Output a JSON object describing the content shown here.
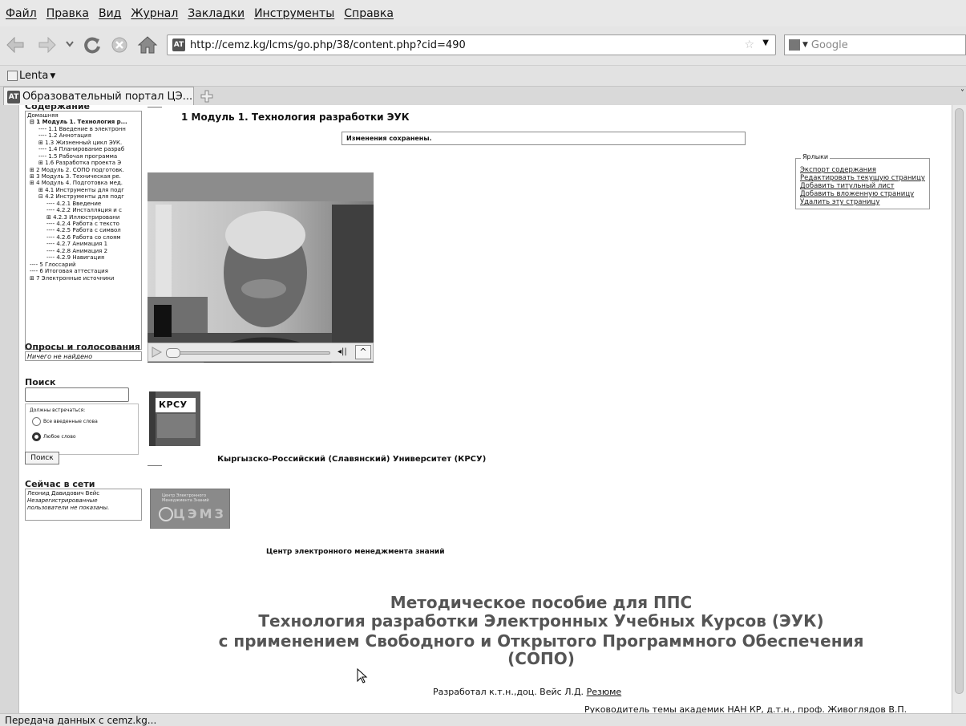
{
  "menu": [
    "Файл",
    "Правка",
    "Вид",
    "Журнал",
    "Закладки",
    "Инструменты",
    "Справка"
  ],
  "url": "http://cemz.kg/lcms/go.php/38/content.php?cid=490",
  "search_engine": "Google",
  "bookmarks_label": "Lenta",
  "tab": {
    "title": "Образовательный портал ЦЭ...",
    "site_icon": "AT"
  },
  "status": "Передача данных с cemz.kg...",
  "sidebar": {
    "contents_title": "Содержание",
    "tree": [
      "Домашняя",
      "⊟ 1 Модуль 1. Технология р...",
      "---- 1.1 Введение в электронн",
      "---- 1.2 Аннотация",
      "⊞ 1.3 Жизненный цикл ЭУК.",
      "---- 1.4 Планирование разраб",
      "---- 1.5 Рабочая программа",
      "⊞ 1.6 Разработка проекта Э",
      "⊞ 2 Модуль 2. СОПО подготовк.",
      "⊞ 3 Модуль 3. Техническая ре.",
      "⊞ 4 Модуль 4. Подготовка мед.",
      "⊞ 4.1 Инструменты для подг",
      "⊟ 4.2 Инструменты для подг",
      "---- 4.2.1 Введение",
      "---- 4.2.2 Инсталляция и с",
      "⊞ 4.2.3 Иллюстрировани",
      "---- 4.2.4 Работа с тексто",
      "---- 4.2.5 Работа с символ",
      "---- 4.2.6 Работа со слоям",
      "---- 4.2.7 Анимация 1",
      "---- 4.2.8 Анимация 2",
      "---- 4.2.9 Навигация",
      "---- 5 Глоссарий",
      "---- 6 Итоговая аттестация",
      "⊞ 7 Электронные источники"
    ],
    "polls_title": "Опросы и голосования",
    "polls_empty": "Ничего не найдено",
    "search_title": "Поиск",
    "search_must": "Должны встречаться:",
    "search_opt_all": "Все введенные слова",
    "search_opt_any": "Любое слово",
    "search_button": "Поиск",
    "online_title": "Сейчас в сети",
    "online_user": "Леонид Давидович Вейс",
    "online_note_1": "Незарегистрированные",
    "online_note_2": "пользователи не показаны."
  },
  "main": {
    "heading": "1 Модуль 1. Технология разработки ЭУК",
    "saved_msg": "Изменения сохранены.",
    "krsu_caption": "Кыргызско-Российский (Славянский) Университет (КРСУ)",
    "krsu_logo": "КРСУ",
    "cemz_caption": "Центр электронного менеджмента знаний",
    "cemz_logo_small": "Центр Электронного Менеджмента Знаний",
    "cemz_logo_big": "ЦЭМЗ",
    "title_1": "Методическое пособие для ППС",
    "title_2": "Технология разработки Электронных Учебных Курсов (ЭУК)",
    "title_3": "с применением Свободного и Открытого Программного Обеспечения",
    "title_4": "(СОПО)",
    "author_prefix": "Разработал к.т.н.,доц. Вейс Л.Д.",
    "author_link": "Резюме",
    "supervisor": "Руководитель темы академик НАН КР, д.т.н., проф. Живоглядов В.П."
  },
  "shortcuts": {
    "legend": "Ярлыки",
    "links": [
      "Экспорт содержания",
      "Редактировать текущую страницу",
      "Добавить титульный лист",
      "Добавить вложенную страницу",
      "Удалить эту страницу"
    ]
  }
}
